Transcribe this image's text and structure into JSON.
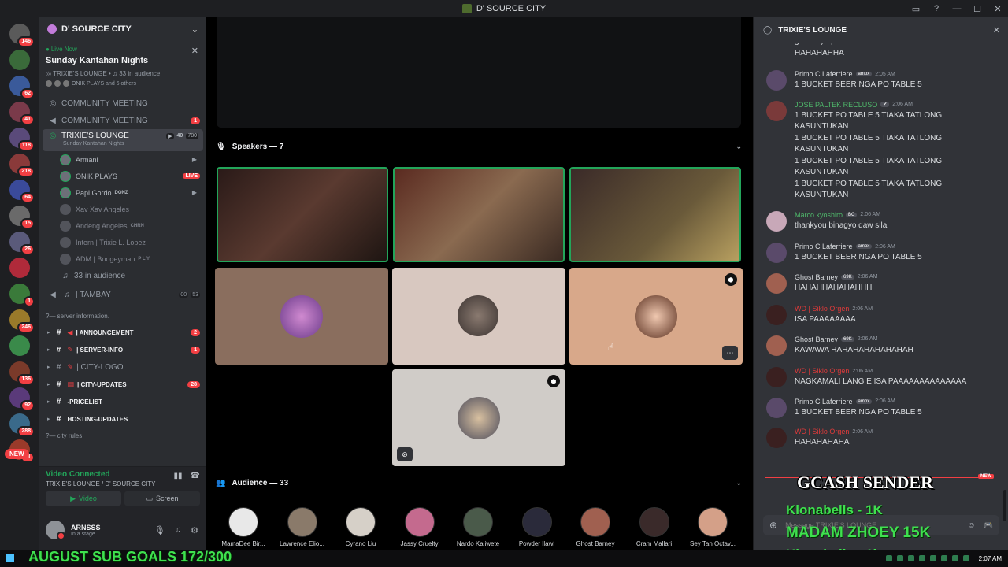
{
  "window": {
    "title": "D' SOURCE CITY"
  },
  "rail": {
    "badges": [
      "146",
      "",
      "62",
      "41",
      "118",
      "218",
      "64",
      "15",
      "26",
      "",
      "1",
      "246",
      "",
      "136",
      "92",
      "288",
      "51"
    ],
    "new_label": "NEW"
  },
  "sidebar": {
    "guild_name": "D' SOURCE CITY",
    "live": {
      "status": "Live Now",
      "event": "Sunday Kantahan Nights",
      "channel": "TRIXIE'S LOUNGE",
      "audience": "33 in audience",
      "others": "ONIK PLAYS and 6 others"
    },
    "channels_top": [
      {
        "name": "COMMUNITY MEETING",
        "count": ""
      },
      {
        "name": "COMMUNITY MEETING",
        "count": "1"
      }
    ],
    "active_channel": {
      "name": "TRIXIE'S LOUNGE",
      "sub": "Sunday Kantahan Nights",
      "cams": "40",
      "users": "780"
    },
    "voice_users": [
      {
        "name": "Armani",
        "tag": "",
        "live": "",
        "dim": false
      },
      {
        "name": "ONIK PLAYS",
        "tag": "",
        "live": "LIVE",
        "dim": false
      },
      {
        "name": "Papi Gordo",
        "tag": "DONZ",
        "live": "",
        "dim": false
      },
      {
        "name": "Xav Xav Angeles",
        "tag": "",
        "live": "",
        "dim": true
      },
      {
        "name": "Andeng Angeles",
        "tag": "CHRN",
        "live": "",
        "dim": true
      },
      {
        "name": "Intern | Trixie L. Lopez",
        "tag": "",
        "live": "",
        "dim": true
      },
      {
        "name": "ADM | Boogeyman",
        "tag": "P L Y",
        "live": "",
        "dim": true
      }
    ],
    "in_audience": "33 in audience",
    "tambay": {
      "name": "| TAMBAY",
      "a": "00",
      "b": "53"
    },
    "cat_server_info": "?— server information.",
    "text_channels": [
      {
        "name": "| ANNOUNCEMENT",
        "count": "2",
        "bold": true
      },
      {
        "name": "| SERVER-INFO",
        "count": "1",
        "bold": true
      },
      {
        "name": "| CITY-LOGO",
        "count": "",
        "bold": false
      },
      {
        "name": "| CITY-UPDATES",
        "count": "28",
        "bold": true
      },
      {
        "name": "-PRICELIST",
        "count": "",
        "bold": true
      },
      {
        "name": "HOSTING-UPDATES",
        "count": "",
        "bold": true
      }
    ],
    "cat_city_rules": "?— city rules.",
    "voice_panel": {
      "status": "Video Connected",
      "location": "TRIXIE'S LOUNGE / D' SOURCE CITY",
      "video_label": "Video",
      "screen_label": "Screen"
    },
    "user": {
      "name": "ARNSSS",
      "status": "In a stage"
    }
  },
  "stage": {
    "speakers_label": "Speakers — 7",
    "audience_label": "Audience — 33",
    "audience": [
      {
        "name": "MamaDee Bir...",
        "color": "#e8e8e8"
      },
      {
        "name": "Lawrence Elio...",
        "color": "#8a7a6a"
      },
      {
        "name": "Cyrano Liu",
        "color": "#d6d0c8"
      },
      {
        "name": "Jassy Cruelty",
        "color": "#c46a8e"
      },
      {
        "name": "Nardo Kaliwete",
        "color": "#4a5a4a"
      },
      {
        "name": "Powder Ilawi",
        "color": "#2a2a3a"
      },
      {
        "name": "Ghost Barney",
        "color": "#a06050"
      },
      {
        "name": "Cram Mallari",
        "color": "#3a2a2a"
      },
      {
        "name": "Sey Tan Octav...",
        "color": "#d4a088"
      }
    ]
  },
  "chat": {
    "title": "TRIXIE'S LOUNGE",
    "placeholder": "Message TRIXIE'S LOUNGE",
    "new_label": "NEW",
    "messages": [
      {
        "name": "",
        "badge": "",
        "time": "",
        "color": "#dbdee1",
        "lines": [
          "gusto nya pala",
          "HAHAHAHHA"
        ],
        "avatar": ""
      },
      {
        "name": "Primo C Laferriere",
        "badge": "ampx",
        "time": "2:05 AM",
        "color": "#dbdee1",
        "lines": [
          "1 BUCKET BEER NGA PO TABLE 5"
        ],
        "avatar": "#5a4a6a"
      },
      {
        "name": "JOSE PALTEK RECLUSO",
        "badge": "✔",
        "time": "2:06 AM",
        "color": "#4fb86b",
        "lines": [
          "1 BUCKET PO TABLE 5 TIAKA TATLONG",
          "KASUNTUKAN",
          "1 BUCKET PO TABLE 5 TIAKA TATLONG",
          "KASUNTUKAN",
          "1 BUCKET PO TABLE 5 TIAKA TATLONG",
          "KASUNTUKAN",
          "1 BUCKET PO TABLE 5 TIAKA TATLONG",
          "KASUNTUKAN"
        ],
        "avatar": "#7a3a3a"
      },
      {
        "name": "Marco kyoshiro",
        "badge": "BC",
        "time": "2:06 AM",
        "color": "#4fb86b",
        "lines": [
          "thankyou binagyo daw sila"
        ],
        "avatar": "#c8a8b8"
      },
      {
        "name": "Primo C Laferriere",
        "badge": "ampx",
        "time": "2:06 AM",
        "color": "#dbdee1",
        "lines": [
          "1 BUCKET BEER NGA PO TABLE 5"
        ],
        "avatar": "#5a4a6a"
      },
      {
        "name": "Ghost Barney",
        "badge": "69K",
        "time": "2:06 AM",
        "color": "#dbdee1",
        "lines": [
          "HAHAHHAHAHAHHH"
        ],
        "avatar": "#a06050"
      },
      {
        "name": "WD | Siklo Orgen",
        "badge": "",
        "time": "2:06 AM",
        "color": "#e03a3a",
        "lines": [
          "ISA PAAAAAAAA"
        ],
        "avatar": "#3a2020"
      },
      {
        "name": "Ghost Barney",
        "badge": "69K",
        "time": "2:06 AM",
        "color": "#dbdee1",
        "lines": [
          "KAWAWA HAHAHAHAHAHAHAH"
        ],
        "avatar": "#a06050"
      },
      {
        "name": "WD | Siklo Orgen",
        "badge": "",
        "time": "2:06 AM",
        "color": "#e03a3a",
        "lines": [
          "NAGKAMALI LANG E ISA PAAAAAAAAAAAAAA"
        ],
        "avatar": "#3a2020"
      },
      {
        "name": "Primo C Laferriere",
        "badge": "ampx",
        "time": "2:06 AM",
        "color": "#dbdee1",
        "lines": [
          "1 BUCKET BEER NGA PO TABLE 5"
        ],
        "avatar": "#5a4a6a"
      },
      {
        "name": "WD | Siklo Orgen",
        "badge": "",
        "time": "2:06 AM",
        "color": "#e03a3a",
        "lines": [
          "HAHAHAHAHA"
        ],
        "avatar": "#3a2020"
      }
    ]
  },
  "overlays": {
    "gcash": "GCASH SENDER",
    "g1": "Klonabells - 1K",
    "g2": "MADAM ZHOEY 15K",
    "g3": "Klonabells - 1k",
    "sub_goals": "AUGUST SUB GOALS 172/300"
  },
  "taskbar": {
    "clock": "2:07 AM"
  },
  "colors": {
    "accent_green": "#23a55a",
    "danger": "#f23f43",
    "overlay_green": "#3fe04f"
  }
}
